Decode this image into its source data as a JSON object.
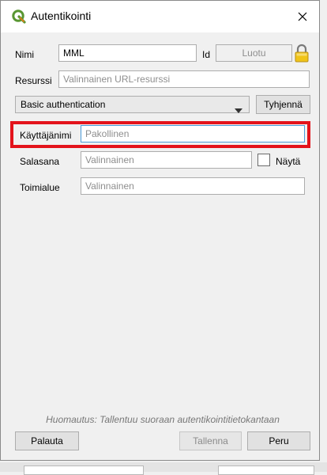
{
  "window": {
    "title": "Autentikointi"
  },
  "form": {
    "name_label": "Nimi",
    "name_value": "MML",
    "id_label": "Id",
    "id_value": "Luotu",
    "resource_label": "Resurssi",
    "resource_placeholder": "Valinnainen URL-resurssi",
    "method_selected": "Basic authentication",
    "clear_button": "Tyhjennä",
    "username_label": "Käyttäjänimi",
    "username_placeholder": "Pakollinen",
    "password_label": "Salasana",
    "password_placeholder": "Valinnainen",
    "show_label": "Näytä",
    "realm_label": "Toimialue",
    "realm_placeholder": "Valinnainen"
  },
  "note": "Huomautus: Tallentuu suoraan autentikointitietokantaan",
  "buttons": {
    "reset": "Palauta",
    "save": "Tallenna",
    "cancel": "Peru"
  },
  "colors": {
    "highlight": "#e3131b",
    "focus_border": "#4a9bd8",
    "qgis_green": "#589632",
    "lock_yellow": "#f0c419"
  }
}
